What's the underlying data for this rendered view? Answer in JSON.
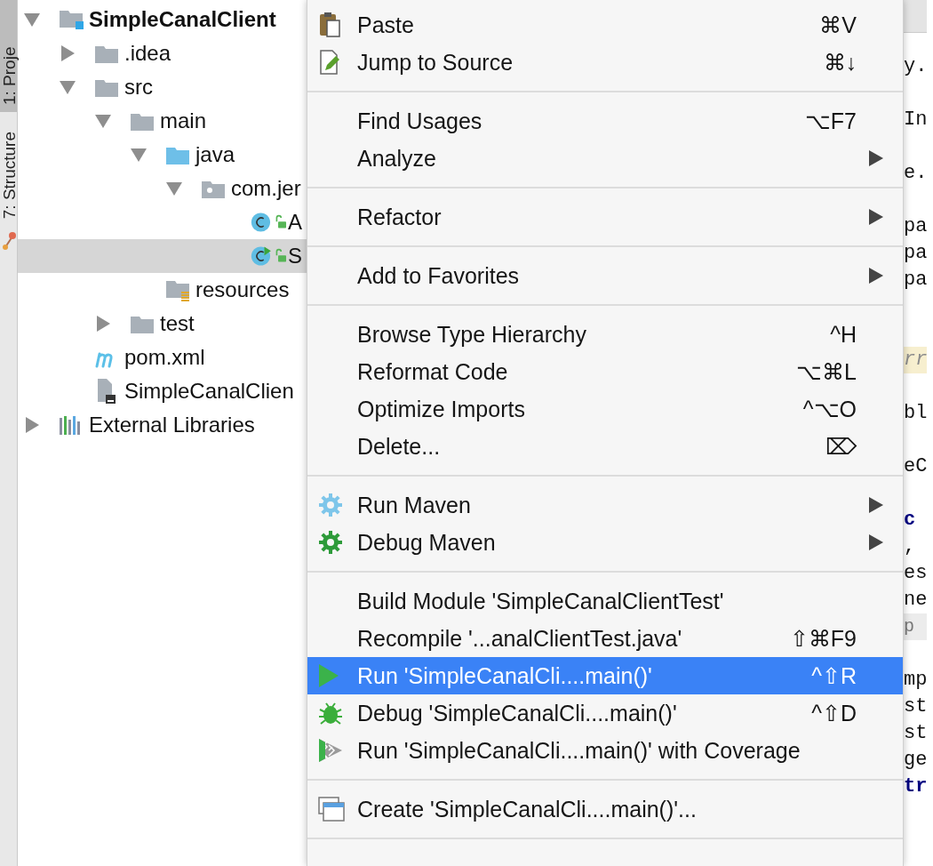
{
  "tool_strip": {
    "tabs": [
      {
        "label": "1: Proje",
        "selected": true
      },
      {
        "label": "7: Structure",
        "selected": false
      }
    ]
  },
  "project_tree": {
    "nodes": [
      {
        "label": "SimpleCanalClient",
        "kind": "module",
        "expanded": true,
        "selected": false,
        "children": [
          {
            "label": ".idea",
            "kind": "folder",
            "expanded": false,
            "selected": false
          },
          {
            "label": "src",
            "kind": "folder",
            "expanded": true,
            "selected": false,
            "children": [
              {
                "label": "main",
                "kind": "folder",
                "expanded": true,
                "selected": false,
                "children": [
                  {
                    "label": "java",
                    "kind": "source-folder",
                    "expanded": true,
                    "selected": false,
                    "children": [
                      {
                        "label": "com.jer",
                        "kind": "package",
                        "expanded": true,
                        "selected": false,
                        "children": [
                          {
                            "label": "A",
                            "kind": "class",
                            "selected": false
                          },
                          {
                            "label": "S",
                            "kind": "main-class",
                            "selected": true
                          }
                        ]
                      }
                    ]
                  },
                  {
                    "label": "resources",
                    "kind": "resources-folder",
                    "selected": false
                  }
                ]
              },
              {
                "label": "test",
                "kind": "folder",
                "expanded": false,
                "selected": false
              }
            ]
          },
          {
            "label": "pom.xml",
            "kind": "maven",
            "selected": false
          },
          {
            "label": "SimpleCanalClien",
            "kind": "iml",
            "selected": false
          }
        ]
      },
      {
        "label": "External Libraries",
        "kind": "libraries",
        "expanded": false,
        "selected": false
      }
    ]
  },
  "context_menu": {
    "items": [
      {
        "kind": "paste",
        "label": "Paste",
        "shortcut": "⌘V",
        "submenu": false,
        "selected": false
      },
      {
        "kind": "jump",
        "label": "Jump to Source",
        "shortcut": "⌘↓",
        "submenu": false,
        "selected": false
      },
      {
        "kind": "separator"
      },
      {
        "kind": "plain",
        "label": "Find Usages",
        "shortcut": "⌥F7",
        "submenu": false,
        "selected": false
      },
      {
        "kind": "plain",
        "label": "Analyze",
        "submenu": true,
        "selected": false
      },
      {
        "kind": "separator"
      },
      {
        "kind": "plain",
        "label": "Refactor",
        "submenu": true,
        "selected": false
      },
      {
        "kind": "separator"
      },
      {
        "kind": "plain",
        "label": "Add to Favorites",
        "submenu": true,
        "selected": false
      },
      {
        "kind": "separator"
      },
      {
        "kind": "plain",
        "label": "Browse Type Hierarchy",
        "shortcut": "^H",
        "submenu": false,
        "selected": false
      },
      {
        "kind": "plain",
        "label": "Reformat Code",
        "shortcut": "⌥⌘L",
        "submenu": false,
        "selected": false
      },
      {
        "kind": "plain",
        "label": "Optimize Imports",
        "shortcut": "^⌥O",
        "submenu": false,
        "selected": false
      },
      {
        "kind": "plain",
        "label": "Delete...",
        "shortcut": "⌦",
        "submenu": false,
        "selected": false
      },
      {
        "kind": "separator"
      },
      {
        "kind": "maven-run",
        "label": "Run Maven",
        "submenu": true,
        "selected": false
      },
      {
        "kind": "maven-debug",
        "label": "Debug Maven",
        "submenu": true,
        "selected": false
      },
      {
        "kind": "separator"
      },
      {
        "kind": "plain",
        "label": "Build Module 'SimpleCanalClientTest'",
        "submenu": false,
        "selected": false
      },
      {
        "kind": "plain",
        "label": "Recompile '...analClientTest.java'",
        "shortcut": "⇧⌘F9",
        "submenu": false,
        "selected": false
      },
      {
        "kind": "run",
        "label": "Run 'SimpleCanalCli....main()'",
        "shortcut": "^⇧R",
        "submenu": false,
        "selected": true
      },
      {
        "kind": "debug",
        "label": "Debug 'SimpleCanalCli....main()'",
        "shortcut": "^⇧D",
        "submenu": false,
        "selected": false
      },
      {
        "kind": "coverage",
        "label": "Run 'SimpleCanalCli....main()' with Coverage",
        "submenu": false,
        "selected": false
      },
      {
        "kind": "separator"
      },
      {
        "kind": "create",
        "label": "Create 'SimpleCanalCli....main()'...",
        "submenu": false,
        "selected": false
      },
      {
        "kind": "separator"
      }
    ]
  },
  "editor": {
    "lines": [
      {
        "text": "y.",
        "kind": "plain"
      },
      {
        "kind": "blank"
      },
      {
        "text": "In",
        "kind": "plain"
      },
      {
        "kind": "blank"
      },
      {
        "text": "e.",
        "kind": "plain"
      },
      {
        "kind": "blank"
      },
      {
        "text": "pa",
        "kind": "plain"
      },
      {
        "text": "pa",
        "kind": "plain"
      },
      {
        "text": "pa",
        "kind": "plain"
      },
      {
        "kind": "blank"
      },
      {
        "kind": "blank"
      },
      {
        "text": "rr",
        "kind": "doc"
      },
      {
        "kind": "blank"
      },
      {
        "text": "bl",
        "kind": "plain"
      },
      {
        "kind": "blank"
      },
      {
        "text": "eC",
        "kind": "plain"
      },
      {
        "kind": "blank"
      },
      {
        "text": "c",
        "kind": "keyword"
      },
      {
        "text": ",",
        "kind": "plain"
      },
      {
        "text": "es",
        "kind": "plain"
      },
      {
        "text": "ne",
        "kind": "plain"
      },
      {
        "text": "p",
        "kind": "hint"
      },
      {
        "kind": "blank"
      },
      {
        "text": "mp",
        "kind": "plain"
      },
      {
        "text": "st",
        "kind": "plain"
      },
      {
        "text": "st",
        "kind": "plain"
      },
      {
        "text": "ge",
        "kind": "plain"
      },
      {
        "text": "tr",
        "kind": "keyword"
      }
    ]
  }
}
